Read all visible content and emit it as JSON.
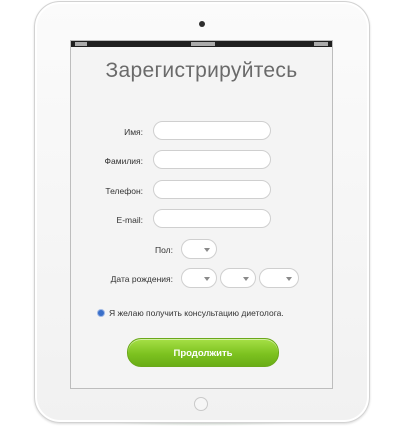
{
  "form": {
    "title": "Зарегистрируйтесь",
    "fields": [
      {
        "label": "Имя:",
        "value": ""
      },
      {
        "label": "Фамилия:",
        "value": ""
      },
      {
        "label": "Телефон:",
        "value": ""
      },
      {
        "label": "E-mail:",
        "value": ""
      }
    ],
    "gender": {
      "label": "Пол:",
      "value": ""
    },
    "birthdate": {
      "label": "Дата рождения:",
      "day": "",
      "month": "",
      "year": ""
    },
    "consult_label": "Я желаю получить консультацию диетолога.",
    "submit_label": "Продолжить"
  },
  "colors": {
    "accent": "#7dc220",
    "radio": "#3a6fc9",
    "title": "#6a6a6a"
  }
}
